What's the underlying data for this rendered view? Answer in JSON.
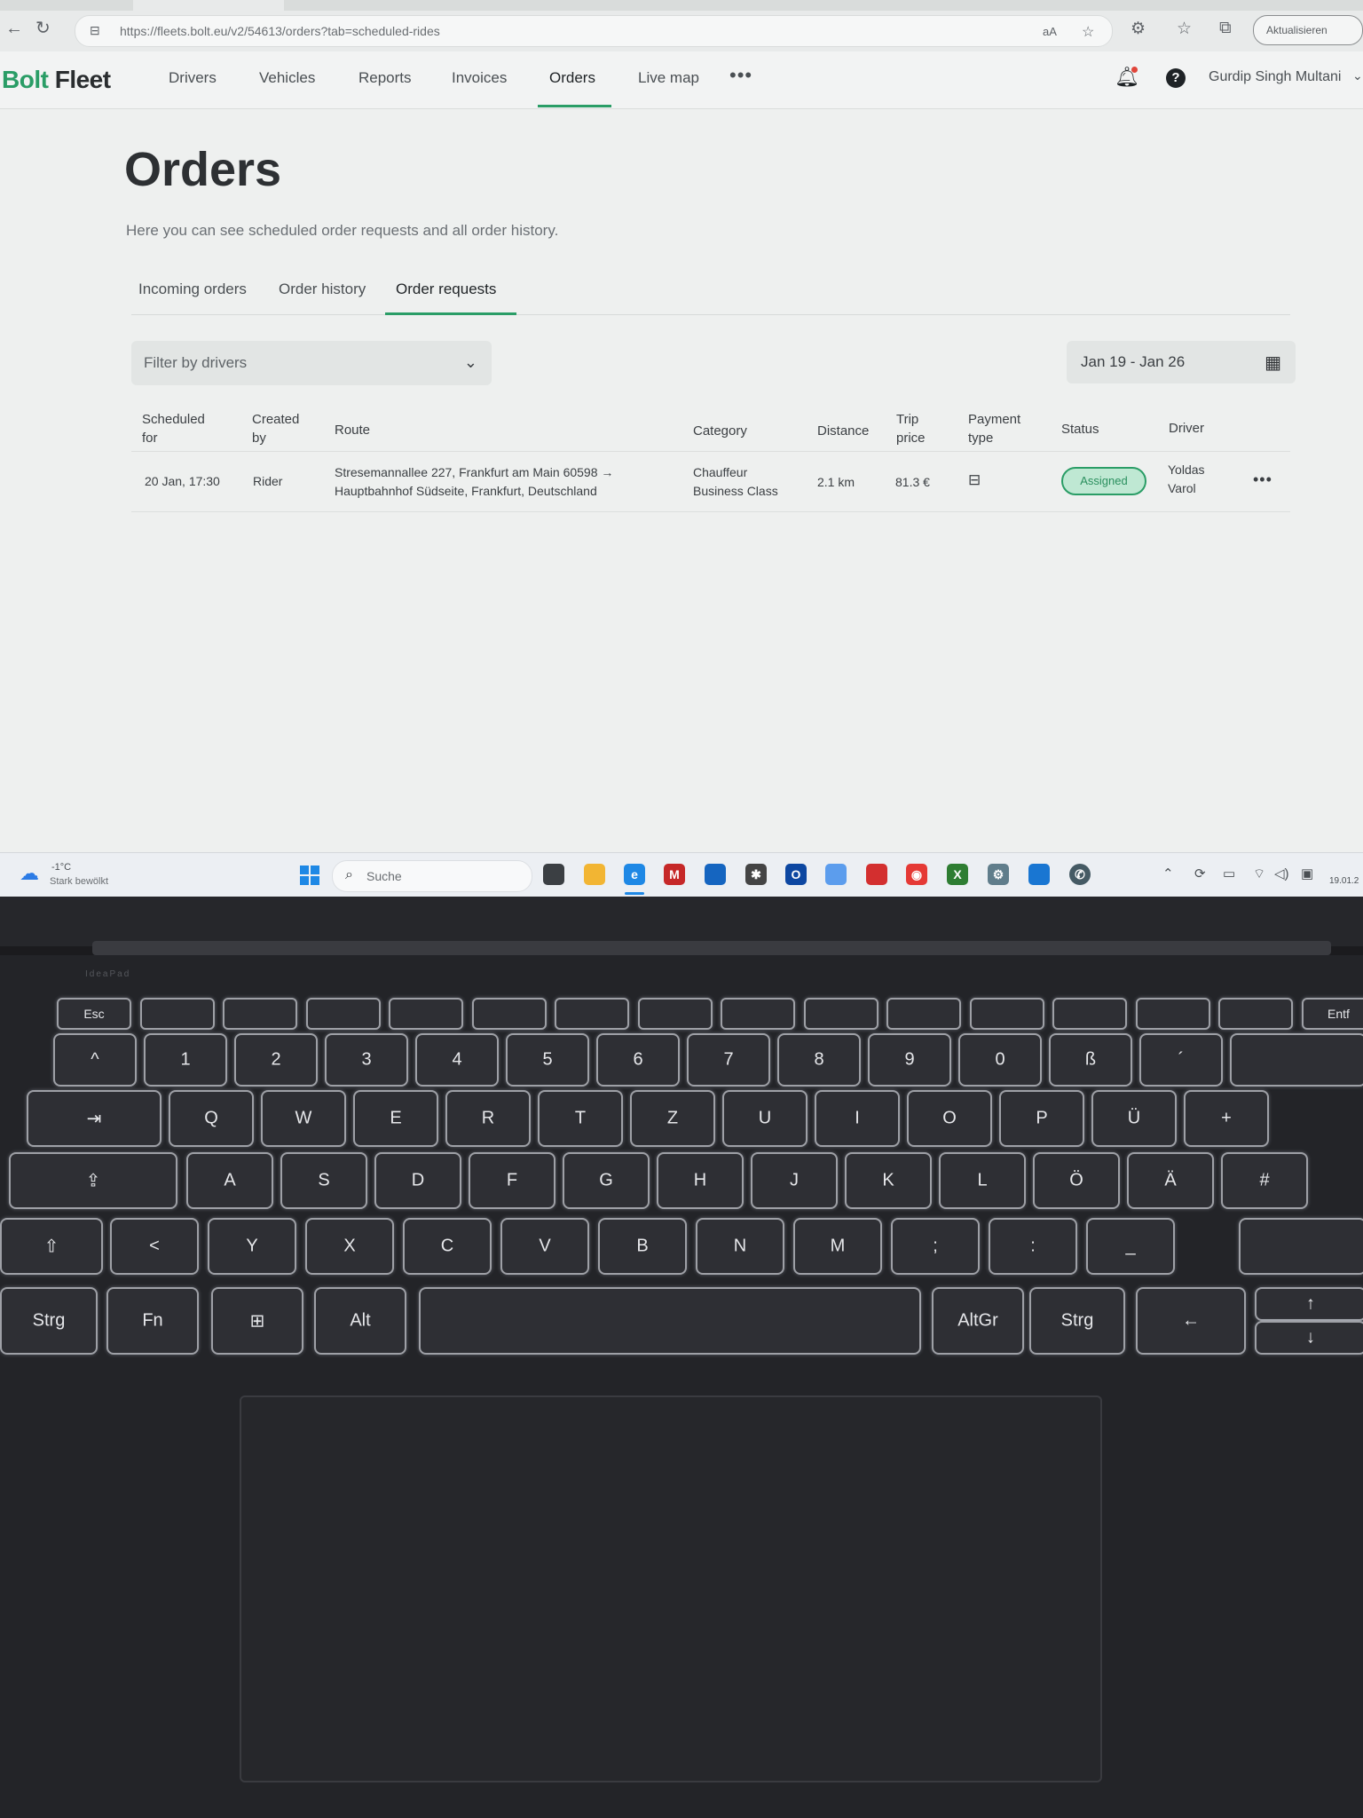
{
  "browser": {
    "url": "https://fleets.bolt.eu/v2/54613/orders?tab=scheduled-rides",
    "translate_label": "aA",
    "update_button": "Aktualisieren"
  },
  "app": {
    "logo_bolt": "Bolt",
    "logo_fleet": " Fleet",
    "nav": [
      "Drivers",
      "Vehicles",
      "Reports",
      "Invoices",
      "Orders",
      "Live map"
    ],
    "more": "•••",
    "user_name": "Gurdip Singh Multani"
  },
  "page": {
    "title": "Orders",
    "subtitle": "Here you can see scheduled order requests and all order history.",
    "tabs": [
      "Incoming orders",
      "Order history",
      "Order requests"
    ],
    "filter_placeholder": "Filter by drivers",
    "date_range": "Jan 19 - Jan 26"
  },
  "table": {
    "headers": {
      "scheduled_for": [
        "Scheduled",
        "for"
      ],
      "created_by": [
        "Created",
        "by"
      ],
      "route": "Route",
      "category": "Category",
      "distance": "Distance",
      "trip_price": [
        "Trip",
        "price"
      ],
      "payment_type": [
        "Payment",
        "type"
      ],
      "status": "Status",
      "driver": "Driver"
    },
    "rows": [
      {
        "scheduled_for": "20 Jan, 17:30",
        "created_by": "Rider",
        "route_line1": "Stresemannallee 227, Frankfurt am Main 60598 →",
        "route_line2": "Hauptbahnhof Südseite, Frankfurt, Deutschland",
        "category_line1": "Chauffeur",
        "category_line2": "Business Class",
        "distance": "2.1 km",
        "trip_price": "81.3 €",
        "payment_icon": "briefcase-icon",
        "status": "Assigned",
        "driver_line1": "Yoldas",
        "driver_line2": "Varol",
        "more": "•••"
      }
    ]
  },
  "taskbar": {
    "weather_temp": "-1°C",
    "weather_desc": "Stark bewölkt",
    "search_placeholder": "Suche",
    "clock": "19.01.2"
  },
  "keyboard": {
    "row_fn": [
      "Esc",
      "",
      "",
      "",
      "",
      "",
      "",
      "",
      "",
      "",
      "",
      "",
      "",
      "",
      "",
      "Entf"
    ],
    "row_num": [
      "^",
      "1",
      "2",
      "3",
      "4",
      "5",
      "6",
      "7",
      "8",
      "9",
      "0",
      "ß",
      "´"
    ],
    "row_q": [
      "Q",
      "W",
      "E",
      "R",
      "T",
      "Z",
      "U",
      "I",
      "O",
      "P",
      "Ü",
      "+"
    ],
    "row_a": [
      "A",
      "S",
      "D",
      "F",
      "G",
      "H",
      "J",
      "K",
      "L",
      "Ö",
      "Ä",
      "#"
    ],
    "row_y": [
      "<",
      "Y",
      "X",
      "C",
      "V",
      "B",
      "N",
      "M",
      ";",
      ":",
      "_"
    ],
    "row_bottom": [
      "Strg",
      "Fn",
      "⊞",
      "Alt",
      "",
      "AltGr",
      "Strg",
      "←",
      "↑",
      "↓"
    ],
    "brand": "IdeaPad"
  },
  "colors": {
    "accent": "#2a9d66",
    "status_bg": "#bfe8d3",
    "keyboard_backlight": "#9ea0a6"
  }
}
